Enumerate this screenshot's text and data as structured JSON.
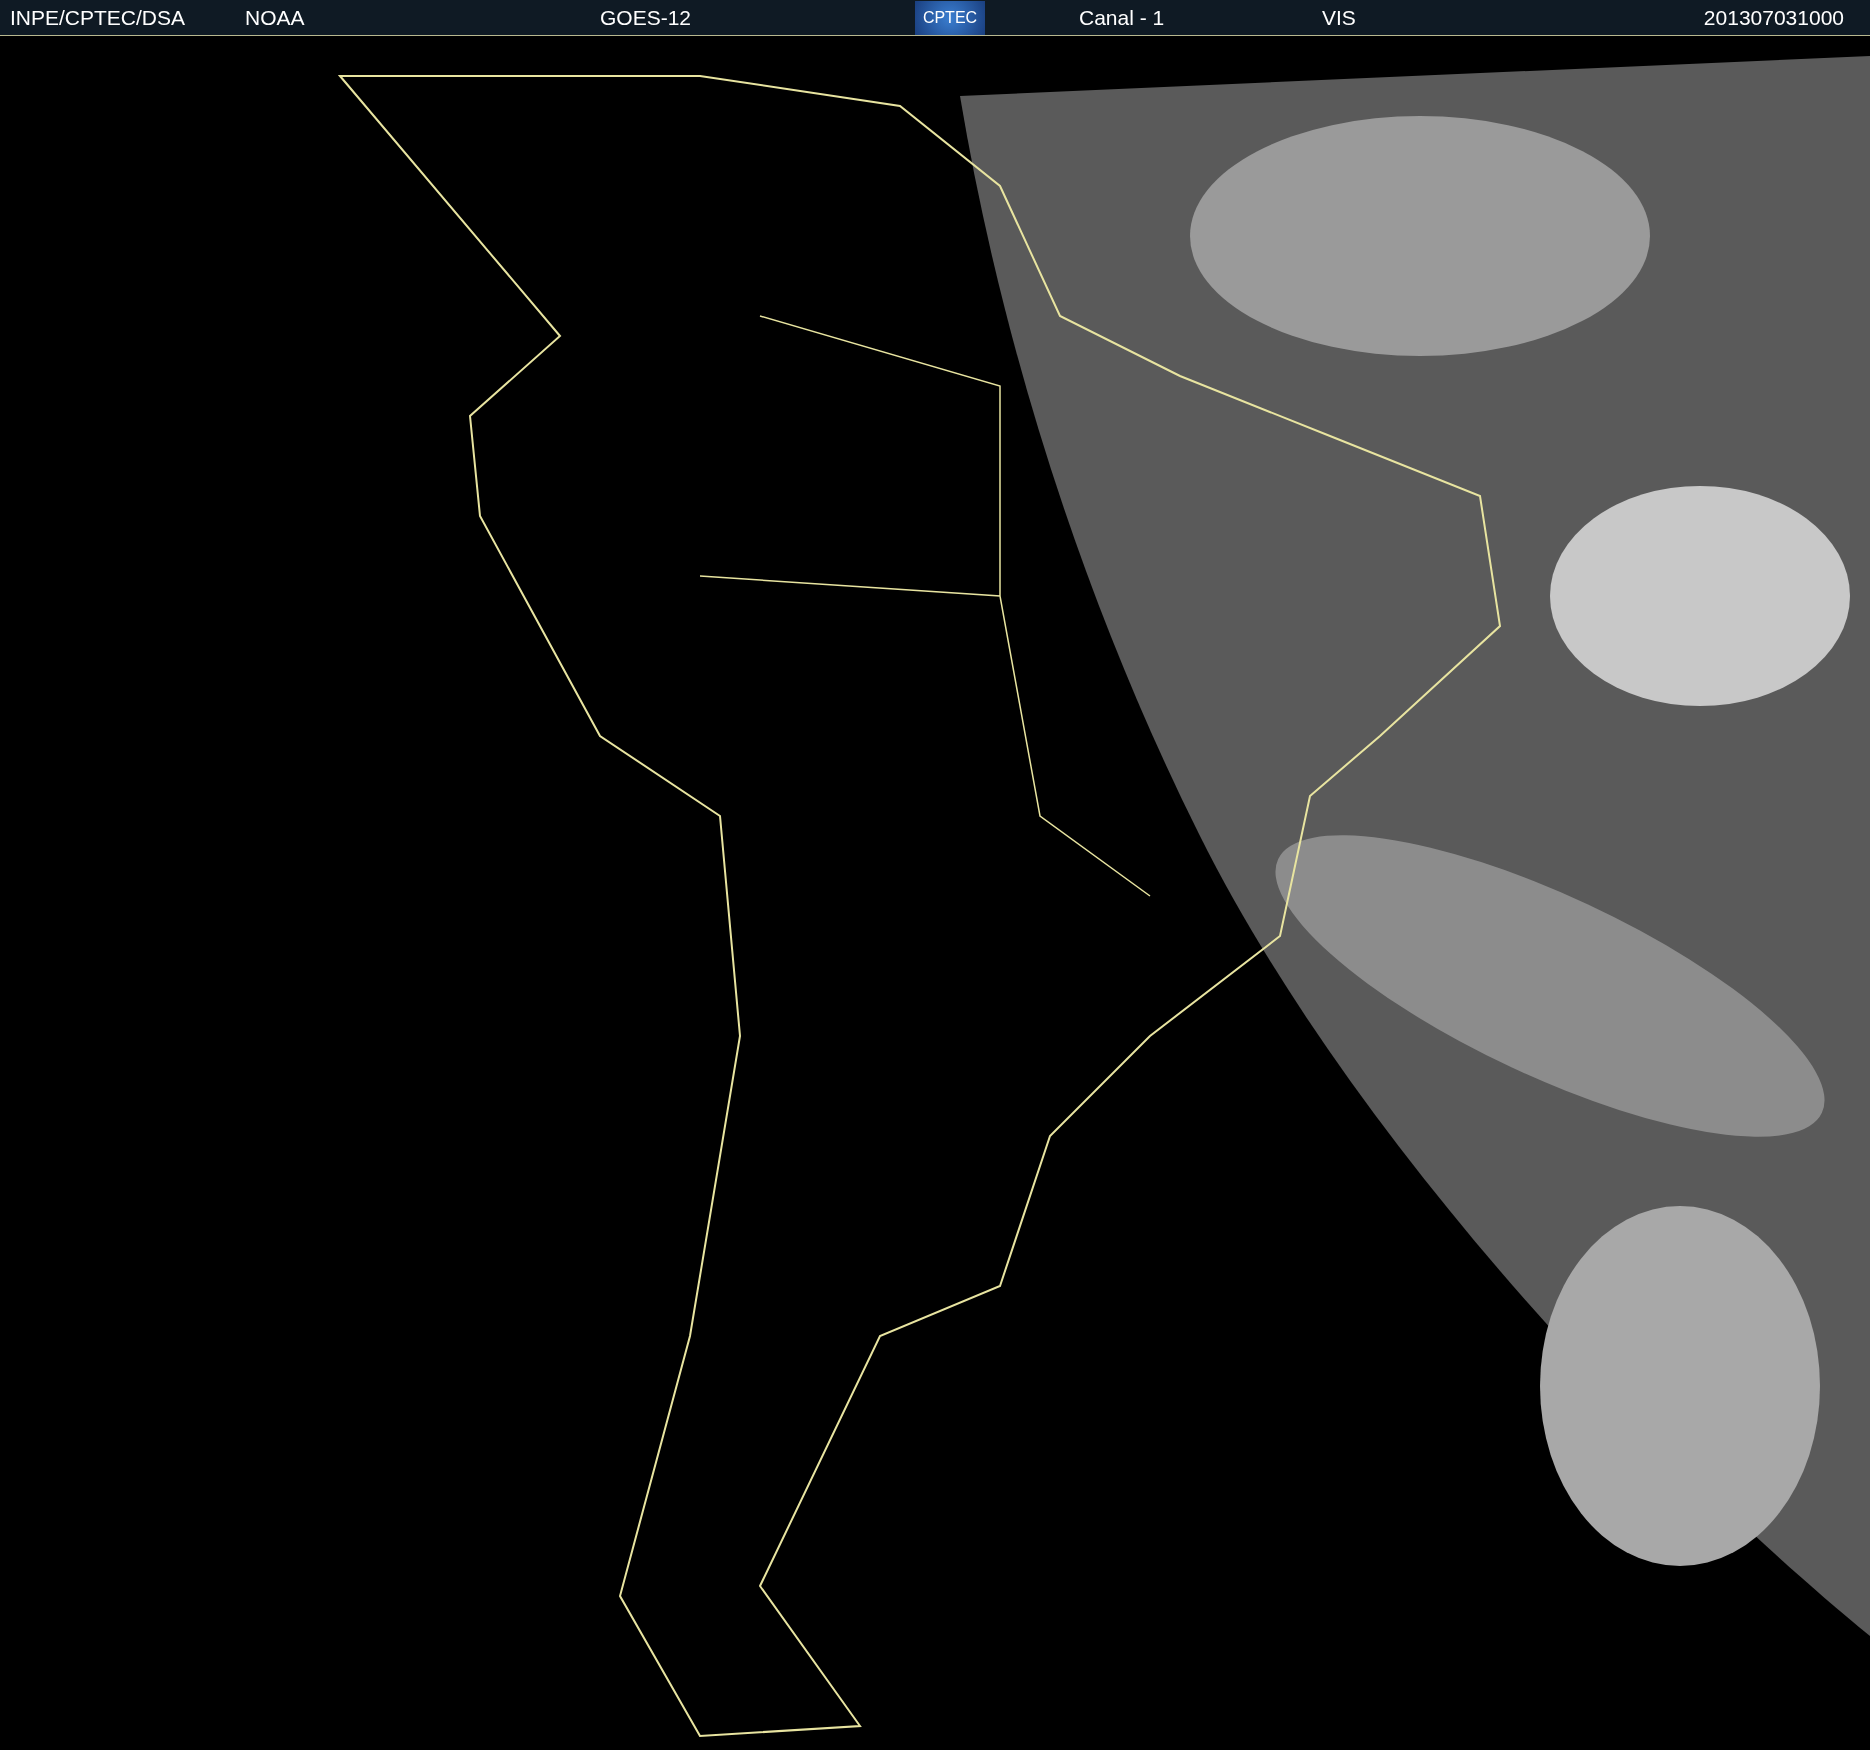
{
  "header": {
    "source": "INPE/CPTEC/DSA",
    "agency": "NOAA",
    "satellite": "GOES-12",
    "logo_text": "CPTEC",
    "channel": "Canal - 1",
    "band": "VIS",
    "timestamp": "201307031000"
  }
}
